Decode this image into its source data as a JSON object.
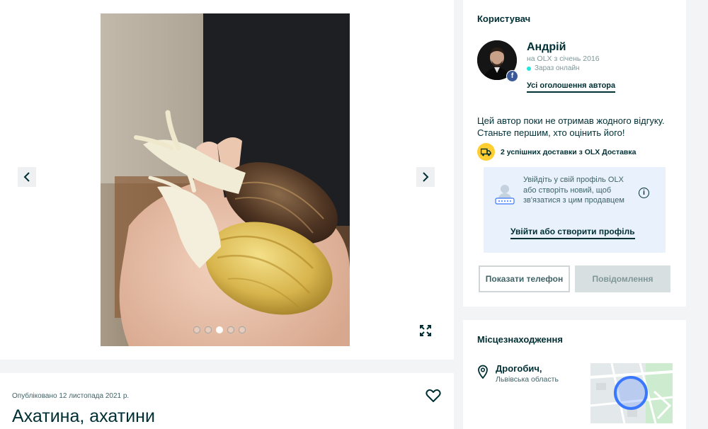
{
  "gallery": {
    "dots_total": 5,
    "active_dot": 3,
    "prev_icon": "chevron-left-icon",
    "next_icon": "chevron-right-icon",
    "expand_icon": "expand-icon"
  },
  "post": {
    "published": "Опубліковано 12 листопада 2021 р.",
    "title": "Ахатина, ахатини",
    "favorite_icon": "heart-icon"
  },
  "user": {
    "section_title": "Користувач",
    "name": "Андрій",
    "since": "на OLX з січень 2016",
    "online": "Зараз онлайн",
    "all_ads_link": "Усі оголошення автора",
    "no_reviews": "Цей автор поки не отримав жодного відгуку. Станьте першим, хто оцінить його!",
    "delivery": "2 успішних доставки з OLX Доставка",
    "login_prompt": "Увійдіть у свій профіль OLX або створіть новий, щоб зв'язатися з цим продавцем",
    "login_link": "Увійти або створити профіль",
    "show_phone": "Показати телефон",
    "message": "Повідомлення",
    "colors": {
      "accent": "#002f34",
      "online": "#23e5db",
      "delivery_badge": "#ffce32",
      "login_box_bg": "#e8f1fc",
      "facebook": "#3b5998"
    }
  },
  "location": {
    "section_title": "Місцезнаходження",
    "city": "Дрогобич,",
    "region": "Львівська область",
    "pin_icon": "map-pin-icon"
  }
}
